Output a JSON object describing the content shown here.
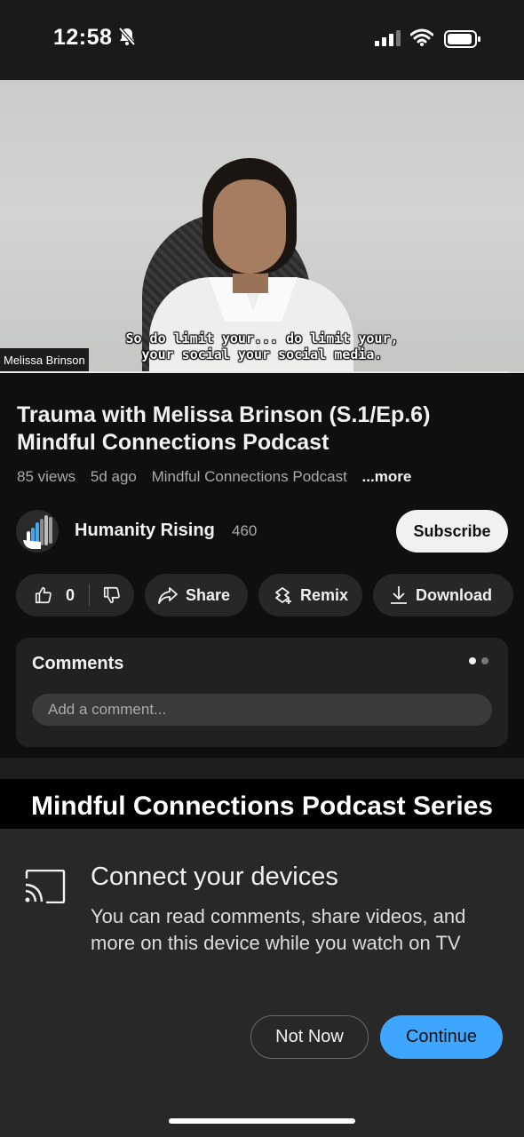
{
  "status_bar": {
    "time": "12:58"
  },
  "video": {
    "caption_line1": "So do limit  your... do limit your,",
    "caption_line2": "your social your social media.",
    "name_tag": "Melissa Brinson",
    "progress": 0.97
  },
  "video_info": {
    "title": "Trauma with Melissa Brinson (S.1/Ep.6) Mindful Connections Podcast",
    "views": "85 views",
    "age": "5d ago",
    "playlist": "Mindful Connections Podcast",
    "more_label": "...more"
  },
  "channel": {
    "name": "Humanity Rising",
    "subscriber_count": "460",
    "subscribe_label": "Subscribe"
  },
  "actions": {
    "like_count": "0",
    "share_label": "Share",
    "remix_label": "Remix",
    "download_label": "Download"
  },
  "comments": {
    "title": "Comments",
    "placeholder": "Add a comment..."
  },
  "next_banner": {
    "text": "Mindful Connections Podcast Series"
  },
  "cast_sheet": {
    "title": "Connect your devices",
    "body": "You can read comments, share videos, and more on this device while you watch on TV",
    "not_now_label": "Not Now",
    "continue_label": "Continue"
  },
  "colors": {
    "background": "#0f0f0f",
    "pill": "#272727",
    "accent_blue": "#3ea6ff",
    "sheet": "#282828"
  }
}
